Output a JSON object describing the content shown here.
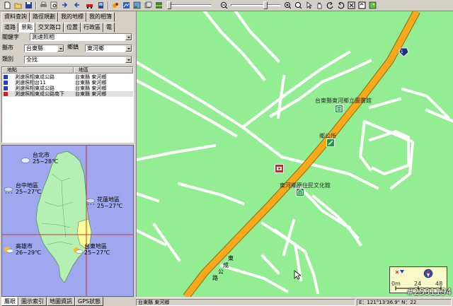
{
  "toolbar": {
    "icons": [
      "new-icon",
      "open-icon",
      "save-icon",
      "print-icon",
      "print-preview-icon",
      "import-icon",
      "export-icon",
      "car-icon",
      "gps-icon",
      "route-icon",
      "settings-icon",
      "picture-icon",
      "zoom-out-icon",
      "zoom-in-icon",
      "pointer-icon",
      "pan-icon",
      "rotate-left-icon",
      "rotate-right-icon",
      "fit-icon",
      "fullscreen-icon",
      "image-icon"
    ]
  },
  "left": {
    "top_tabs": [
      "資料查詢",
      "路徑規劃",
      "我的地標",
      "我的相簿"
    ],
    "sub_tabs": [
      "道路",
      "景點",
      "交叉路口",
      "位置",
      "行政區",
      "電"
    ],
    "search": {
      "keyword_label": "關鍵字",
      "keyword_value": "測速照相",
      "county_label": "縣市",
      "county_value": "台東縣",
      "township_label": "鄉鎮",
      "township_value": "東河鄉",
      "category_label": "類別",
      "category_value": "全找"
    },
    "results": {
      "headers": [
        "地點",
        "地區"
      ],
      "rows": [
        {
          "place": "測速照相東成公路",
          "area": "台東縣 東河鄉"
        },
        {
          "place": "測速照相台11",
          "area": "台東縣 東河鄉"
        },
        {
          "place": "測速照相東成公路",
          "area": "台東縣 東河鄉"
        },
        {
          "place": "測速照相東成公路南下",
          "area": "台東縣 東河鄉"
        }
      ]
    },
    "weather": {
      "cities": [
        {
          "name": "台北市",
          "temp": "25~28℃"
        },
        {
          "name": "台中地區",
          "temp": "25~27℃"
        },
        {
          "name": "花蓮地區",
          "temp": "25~27℃"
        },
        {
          "name": "高雄市",
          "temp": "26~29℃"
        },
        {
          "name": "台東地區",
          "temp": "25~27℃"
        }
      ]
    },
    "bottom_tabs": [
      "鷹眼",
      "圖示索引",
      "地圖資訊",
      "GPS狀態"
    ]
  },
  "map": {
    "pois": {
      "library": "台東縣東河鄉立圖書館",
      "office": "鄉公所",
      "culture": "東河鄉原住民文化館"
    },
    "road_shield": "11",
    "road_name": [
      "東",
      "成",
      "公",
      "路"
    ],
    "scale": {
      "labels": [
        "0m",
        "24",
        "48"
      ]
    }
  },
  "status": {
    "location": "台東縣 東河鄉",
    "coords": "E：121°13'36.9\"  N：22",
    "watermark": "#2531194"
  },
  "colors": {
    "map_bg": "#93ee93",
    "road_main": "#f7a81b",
    "road_minor": "#ffffff",
    "weather_bg": "#9fa8ee",
    "land": "#b4f0b4",
    "highlight": "#ffff99"
  }
}
